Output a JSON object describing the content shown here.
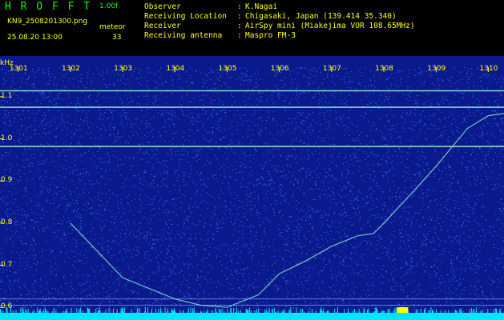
{
  "header": {
    "app_title": "H R O F F T",
    "version": "1.00f",
    "file_name": "KN9_2508201300.png",
    "mode": "meteor",
    "datetime": "25.08.20 13:00",
    "count": "33",
    "info": [
      {
        "key": "Observer",
        "value": "K.Nagai"
      },
      {
        "key": "Receiving Location",
        "value": "Chigasaki, Japan (139.414 35.340)"
      },
      {
        "key": "Receiver",
        "value": "AirSpy mini (Miakejima VOR 108.65MHz)"
      },
      {
        "key": "Receiving antenna",
        "value": "Maspro FM-3"
      }
    ],
    "separator": ":"
  },
  "chart_data": {
    "type": "heatmap",
    "ylabel": "kHz",
    "y_ticks": [
      "1.1",
      "1.0",
      "0.9",
      "0.8",
      "0.7",
      "0.6"
    ],
    "y_tick_values": [
      1.1,
      1.0,
      0.9,
      0.8,
      0.7,
      0.6
    ],
    "x_ticks": [
      "1301",
      "1302",
      "1303",
      "1304",
      "1305",
      "1306",
      "1307",
      "1308",
      "1309",
      "1310"
    ],
    "x_tick_values": [
      1301,
      1302,
      1303,
      1304,
      1305,
      1306,
      1307,
      1308,
      1309,
      1310
    ],
    "xlim": [
      1300.65,
      1310.3
    ],
    "ylim": [
      0.57,
      1.17
    ],
    "horizontal_lines_khz": [
      1.114,
      1.075,
      0.982
    ],
    "lower_lines_khz": [
      0.62,
      0.605
    ],
    "signal_trace": {
      "x": [
        1302.0,
        1303.0,
        1304.0,
        1304.5,
        1305.0,
        1305.6,
        1306.0,
        1306.5,
        1307.0,
        1307.5,
        1307.8,
        1308.0,
        1308.3,
        1308.6,
        1309.0,
        1309.3,
        1309.6,
        1310.0,
        1310.3
      ],
      "y": [
        0.8,
        0.67,
        0.62,
        0.605,
        0.6,
        0.63,
        0.68,
        0.71,
        0.745,
        0.77,
        0.775,
        0.8,
        0.84,
        0.88,
        0.935,
        0.98,
        1.025,
        1.055,
        1.06
      ]
    },
    "colors": {
      "background": "#0a1a8c",
      "noise": "#3a6cff",
      "line": "#8cf0d0",
      "baseline": "#00e5ff",
      "labels": "#ffff00"
    }
  }
}
